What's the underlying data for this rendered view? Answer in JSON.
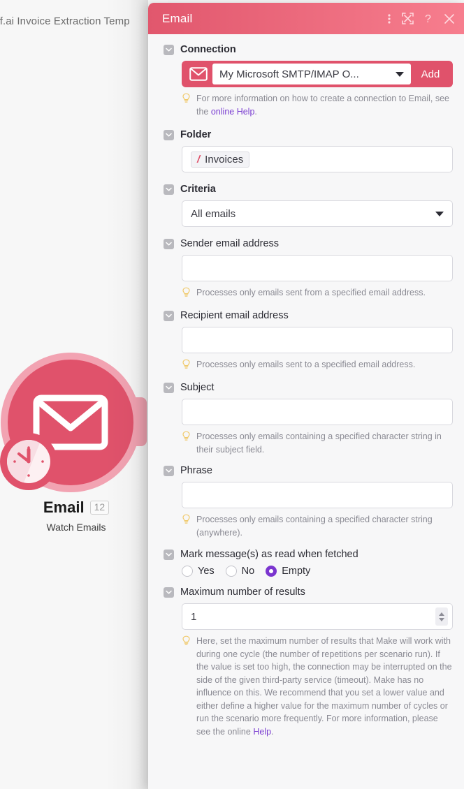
{
  "canvas": {
    "breadcrumb": "tif.ai Invoice Extraction Temp",
    "module": {
      "name": "Email",
      "badge": "12",
      "subtitle": "Watch Emails",
      "icon": "envelope-icon",
      "schedule_icon": "clock-icon",
      "color": "#e0526b",
      "halo_color": "#f2a3b2"
    }
  },
  "panel": {
    "title": "Email",
    "header_gradient_from": "#e1576d",
    "header_gradient_to": "#f77e8e",
    "header_icons": [
      {
        "name": "more-options-icon",
        "glyph": "kebab"
      },
      {
        "name": "expand-icon",
        "glyph": "expand"
      },
      {
        "name": "help-icon",
        "glyph": "question"
      },
      {
        "name": "close-icon",
        "glyph": "close"
      }
    ],
    "fields": {
      "connection": {
        "label": "Connection",
        "icon": "envelope-icon",
        "value": "My Microsoft SMTP/IMAP O...",
        "add_label": "Add",
        "hint_prefix": "For more information on how to create a connection to Email, see the ",
        "hint_link": "online Help",
        "hint_suffix": "."
      },
      "folder": {
        "label": "Folder",
        "chip_prefix": "/",
        "chip_value": "Invoices"
      },
      "criteria": {
        "label": "Criteria",
        "value": "All emails"
      },
      "sender": {
        "label": "Sender email address",
        "value": "",
        "hint": "Processes only emails sent from a specified email address."
      },
      "recipient": {
        "label": "Recipient email address",
        "value": "",
        "hint": "Processes only emails sent to a specified email address."
      },
      "subject": {
        "label": "Subject",
        "value": "",
        "hint": "Processes only emails containing a specified character string in their subject field."
      },
      "phrase": {
        "label": "Phrase",
        "value": "",
        "hint": "Processes only emails containing a specified character string (anywhere)."
      },
      "mark_read": {
        "label": "Mark message(s) as read when fetched",
        "options": [
          "Yes",
          "No",
          "Empty"
        ],
        "selected": "Empty",
        "selected_color": "#7b35cf"
      },
      "max_results": {
        "label": "Maximum number of results",
        "value": "1",
        "hint_text": "Here, set the maximum number of results that Make will work with during one cycle (the number of repetitions per scenario run). If the value is set too high, the connection may be interrupted on the side of the given third-party service (timeout). Make has no influence on this. We recommend that you set a lower value and either define a higher value for the maximum number of cycles or run the scenario more frequently. For more information, please see the online ",
        "hint_link": "Help",
        "hint_suffix": "."
      }
    }
  }
}
